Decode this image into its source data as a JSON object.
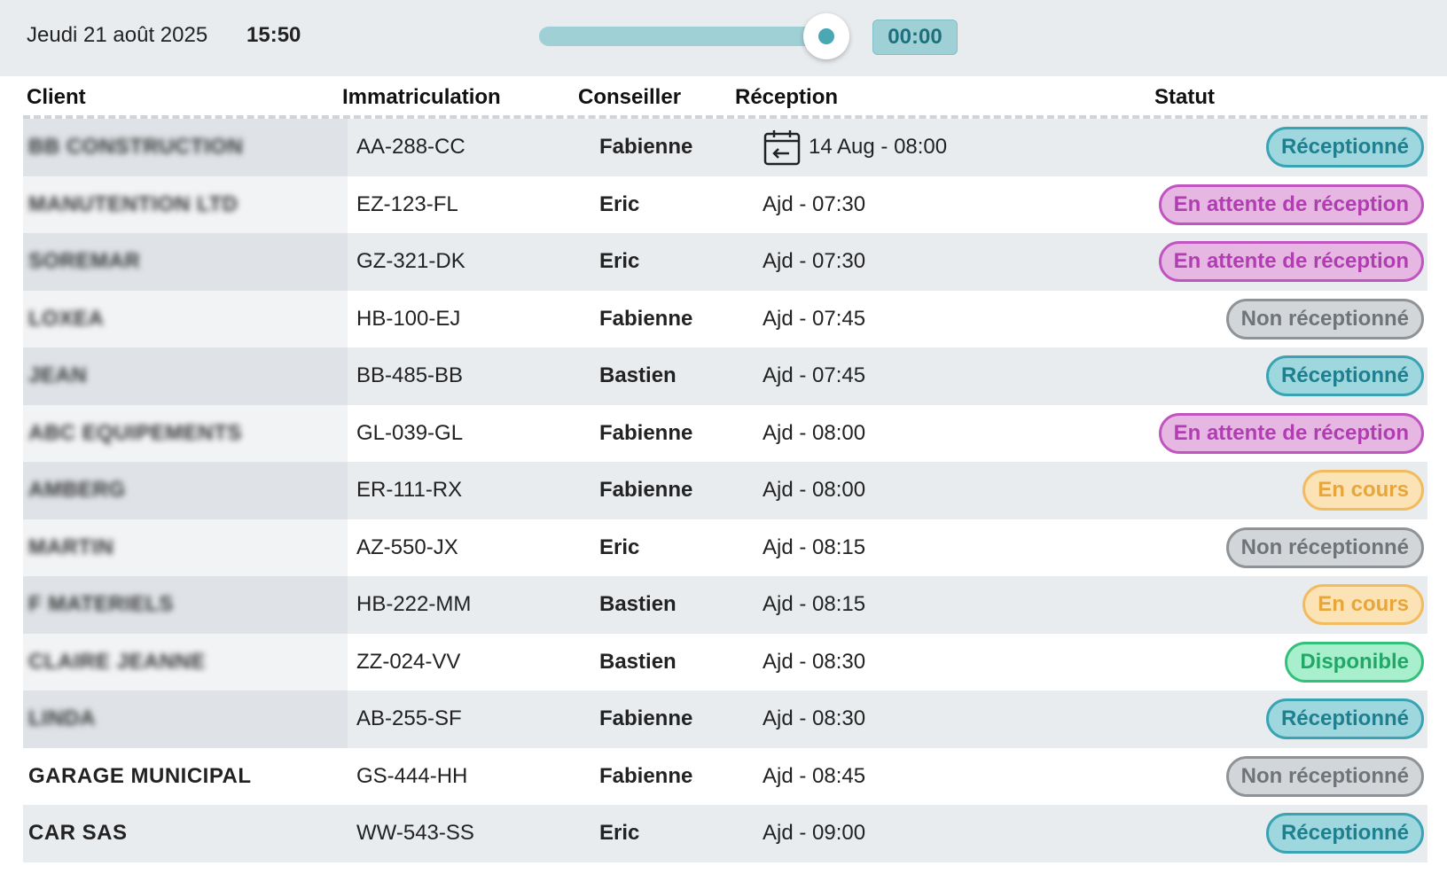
{
  "header": {
    "date": "Jeudi 21 août 2025",
    "time": "15:50",
    "slider_value_pct": 100,
    "timer": "00:00"
  },
  "columns": {
    "client": "Client",
    "immatriculation": "Immatriculation",
    "conseiller": "Conseiller",
    "reception": "Réception",
    "statut": "Statut"
  },
  "rows": [
    {
      "client": "BB CONSTRUCTION",
      "blurred": true,
      "immatriculation": "AA-288-CC",
      "conseiller": "Fabienne",
      "reception": "14 Aug - 08:00",
      "reception_icon": "calendar-transfer-icon",
      "statut": "Réceptionné",
      "statut_style": "teal"
    },
    {
      "client": "MANUTENTION LTD",
      "blurred": true,
      "immatriculation": "EZ-123-FL",
      "conseiller": "Eric",
      "reception": "Ajd - 07:30",
      "statut": "En attente de réception",
      "statut_style": "pink"
    },
    {
      "client": "SOREMAR",
      "blurred": true,
      "immatriculation": "GZ-321-DK",
      "conseiller": "Eric",
      "reception": "Ajd - 07:30",
      "statut": "En attente de réception",
      "statut_style": "pink"
    },
    {
      "client": "LOXEA",
      "blurred": true,
      "immatriculation": "HB-100-EJ",
      "conseiller": "Fabienne",
      "reception": "Ajd - 07:45",
      "statut": "Non réceptionné",
      "statut_style": "gray"
    },
    {
      "client": "JEAN",
      "blurred": true,
      "immatriculation": "BB-485-BB",
      "conseiller": "Bastien",
      "reception": "Ajd - 07:45",
      "statut": "Réceptionné",
      "statut_style": "teal"
    },
    {
      "client": "ABC EQUIPEMENTS",
      "blurred": true,
      "immatriculation": "GL-039-GL",
      "conseiller": "Fabienne",
      "reception": "Ajd - 08:00",
      "statut": "En attente de réception",
      "statut_style": "pink"
    },
    {
      "client": "AMBERG",
      "blurred": true,
      "immatriculation": "ER-111-RX",
      "conseiller": "Fabienne",
      "reception": "Ajd - 08:00",
      "statut": "En cours",
      "statut_style": "yellow"
    },
    {
      "client": "MARTIN",
      "blurred": true,
      "immatriculation": "AZ-550-JX",
      "conseiller": "Eric",
      "reception": "Ajd - 08:15",
      "statut": "Non réceptionné",
      "statut_style": "gray"
    },
    {
      "client": "F MATERIELS",
      "blurred": true,
      "immatriculation": "HB-222-MM",
      "conseiller": "Bastien",
      "reception": "Ajd - 08:15",
      "statut": "En cours",
      "statut_style": "yellow"
    },
    {
      "client": "CLAIRE JEANNE",
      "blurred": true,
      "immatriculation": "ZZ-024-VV",
      "conseiller": "Bastien",
      "reception": "Ajd - 08:30",
      "statut": "Disponible",
      "statut_style": "green"
    },
    {
      "client": "LINDA",
      "blurred": true,
      "immatriculation": "AB-255-SF",
      "conseiller": "Fabienne",
      "reception": "Ajd - 08:30",
      "statut": "Réceptionné",
      "statut_style": "teal"
    },
    {
      "client": "GARAGE MUNICIPAL",
      "blurred": false,
      "immatriculation": "GS-444-HH",
      "conseiller": "Fabienne",
      "reception": "Ajd - 08:45",
      "statut": "Non réceptionné",
      "statut_style": "gray"
    },
    {
      "client": "CAR SAS",
      "blurred": false,
      "immatriculation": "WW-543-SS",
      "conseiller": "Eric",
      "reception": "Ajd - 09:00",
      "statut": "Réceptionné",
      "statut_style": "teal"
    }
  ],
  "colors": {
    "teal": "#3aa3b3",
    "pink": "#c055bf",
    "gray": "#8e9398",
    "yellow": "#f2bb5f",
    "green": "#34c07b",
    "topbar_bg": "#e9ecef"
  }
}
